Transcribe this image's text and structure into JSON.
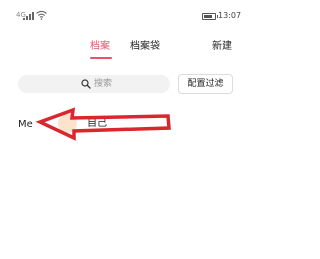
{
  "status_bar": {
    "signal_label": "4G",
    "time": "13:07",
    "battery_level": 0.8
  },
  "tabs": [
    {
      "label": "档案",
      "active": true
    },
    {
      "label": "档案袋",
      "active": false
    },
    {
      "label": "新建",
      "active": false
    }
  ],
  "search": {
    "placeholder": "搜索"
  },
  "filter_button": {
    "label": "配置过滤"
  },
  "list": [
    {
      "name": "Me",
      "tag": "自己"
    }
  ],
  "colors": {
    "accent": "#e5536b",
    "annotation_arrow": "#d9272e",
    "avatar_circle": "#fde3cd"
  }
}
